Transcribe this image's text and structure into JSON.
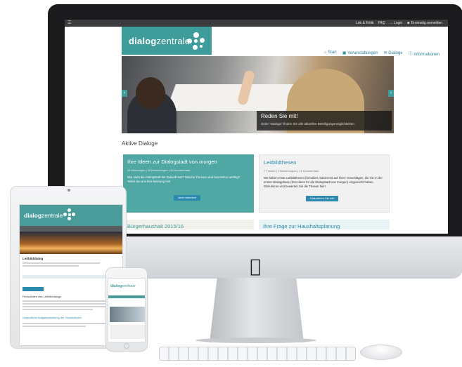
{
  "desktop": {
    "topbar": {
      "menu_icon": "☰",
      "links": [
        "Lob & Kritik",
        "FAQ",
        "Login",
        "Erstmalig anmelden"
      ]
    },
    "logo": {
      "part1": "dialog",
      "part2": "zentrale"
    },
    "nav": [
      "Start",
      "Veranstaltungen",
      "Dialoge",
      "Informationen"
    ],
    "hero": {
      "title": "Reden Sie mit!",
      "subtitle": "Unter \"Dialoge\" finden Sie alle aktuellen Beteiligungsmöglichkeiten.",
      "prev": "‹",
      "next": "›"
    },
    "section_title": "Aktive Dialoge",
    "cards": [
      {
        "title": "Ihre Ideen zur Dialogstadt von morgen",
        "meta": "44 Meinungen | 32 Bewertungen | 45 Kommentare",
        "text": "Wie sieht die Dialogstadt der Zukunft aus? Welche Themen sind besonders wichtig? Teilen Sie uns Ihre Meinung mit!",
        "button": "Jetzt mitreden!"
      },
      {
        "title": "Leitbildthesen",
        "meta": "7 Thesen | 4 Bewertungen | 14 Kommentare",
        "text": "Wir haben erste Leitbildthesen formuliert, basierend auf Ihren Vorschlägen, die Sie in der ersten Dialogphase (Ihre Ideen für die Dialogstadt von morgen) eingereicht haben. Diskutieren und bewerten Sie die Thesen hier!",
        "button": "Diskutieren Sie mit!"
      }
    ],
    "bottom_cards": [
      "Bürgerhaushalt 2015/16",
      "Ihre Frage zur Haushaltsplanung"
    ]
  },
  "tablet": {
    "logo": {
      "part1": "dialog",
      "part2": "zentrale"
    },
    "title": "Leitbilddialog",
    "subtitle": "Ressultaten des Leitbilddialogs",
    "link": "Ursachliche Aufgabenstellung der Hochschulen"
  },
  "phone": {
    "logo": {
      "part1": "dialog",
      "part2": "zentrale"
    }
  },
  "colors": {
    "teal": "#3e9c9a",
    "link_blue": "#2b8cab",
    "button_blue": "#2c8ab0",
    "topbar": "#3b3c3e"
  },
  "icons": {
    "apple": ""
  }
}
